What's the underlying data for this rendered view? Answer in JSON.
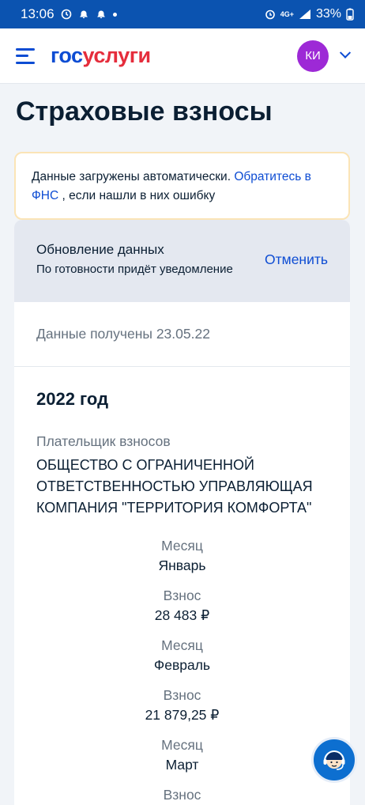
{
  "status_bar": {
    "time": "13:06",
    "network": "4G+",
    "battery": "33%"
  },
  "header": {
    "logo_part1": "гос",
    "logo_part2": "услуги",
    "avatar_initials": "КИ"
  },
  "page": {
    "title": "Страховые взносы"
  },
  "notice": {
    "text_before": "Данные загружены автоматически. ",
    "link": "Обратитесь в ФНС",
    "text_after": " , если нашли в них ошибку"
  },
  "update": {
    "title": "Обновление данных",
    "subtitle": "По готовности придёт уведомление",
    "cancel": "Отменить"
  },
  "received": "Данные получены 23.05.22",
  "year": "2022 год",
  "payer_label": "Плательщик взносов",
  "payer": "ОБЩЕСТВО С ОГРАНИЧЕННОЙ ОТВЕТСТВЕННОСТЬЮ УПРАВЛЯЮЩАЯ КОМПАНИЯ \"ТЕРРИТОРИЯ КОМФОРТА\"",
  "rows": [
    {
      "label": "Месяц",
      "value": "Январь"
    },
    {
      "label": "Взнос",
      "value": "28 483 ₽"
    },
    {
      "label": "Месяц",
      "value": "Февраль"
    },
    {
      "label": "Взнос",
      "value": "21 879,25 ₽"
    },
    {
      "label": "Месяц",
      "value": "Март"
    },
    {
      "label": "Взнос",
      "value": ""
    }
  ],
  "colors": {
    "accent": "#0d4cd3",
    "brand_red": "#e52d3c",
    "status_bar": "#0b53b0",
    "avatar": "#9d29d6"
  }
}
